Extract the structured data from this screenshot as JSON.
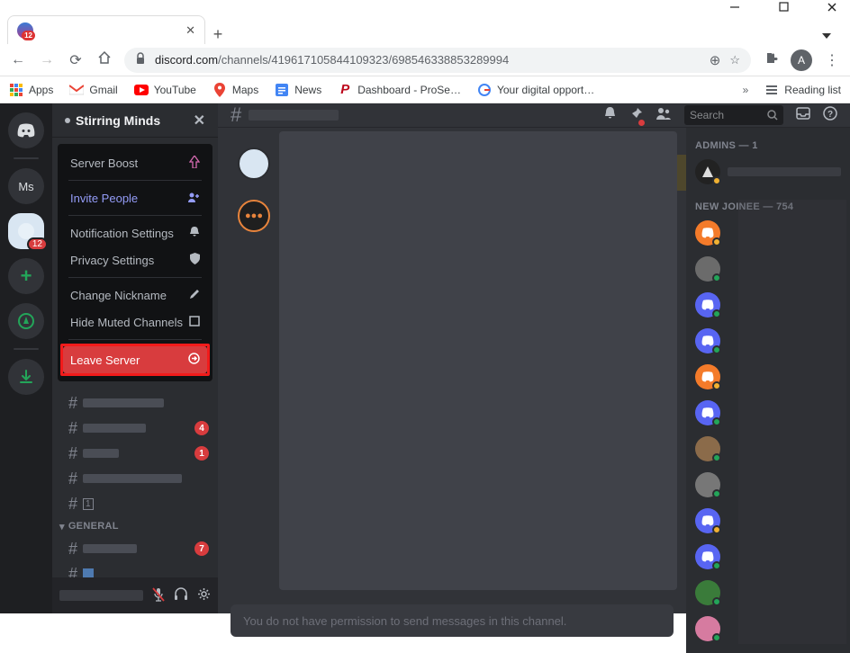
{
  "window": {
    "favicon_badge": "12"
  },
  "browser": {
    "url_host": "discord.com",
    "url_path": "/channels/419617105844109323/698546338853289994",
    "avatar_letter": "A",
    "apps_label": "Apps",
    "bookmarks": [
      {
        "label": "Gmail",
        "icon": "gmail"
      },
      {
        "label": "YouTube",
        "icon": "youtube"
      },
      {
        "label": "Maps",
        "icon": "maps"
      },
      {
        "label": "News",
        "icon": "news"
      },
      {
        "label": "Dashboard - ProSe…",
        "icon": "pinterest"
      },
      {
        "label": "Your digital opport…",
        "icon": "google"
      }
    ],
    "reading_list": "Reading list"
  },
  "discord": {
    "guilds": {
      "ms_label": "Ms",
      "selected_badge": "12"
    },
    "server_name": "Stirring Minds",
    "context_menu": {
      "server_boost": "Server Boost",
      "invite_people": "Invite People",
      "notification_settings": "Notification Settings",
      "privacy_settings": "Privacy Settings",
      "change_nickname": "Change Nickname",
      "hide_muted": "Hide Muted Channels",
      "leave_server": "Leave Server"
    },
    "channel_badges": {
      "b1": "4",
      "b2": "1",
      "b3": "7"
    },
    "category_general": "GENERAL",
    "search_placeholder": "Search",
    "message_input_placeholder": "You do not have permission to send messages in this channel.",
    "members": {
      "admins_title": "ADMINS — 1",
      "newjoinee_title": "NEW JOINEE — 754"
    }
  }
}
